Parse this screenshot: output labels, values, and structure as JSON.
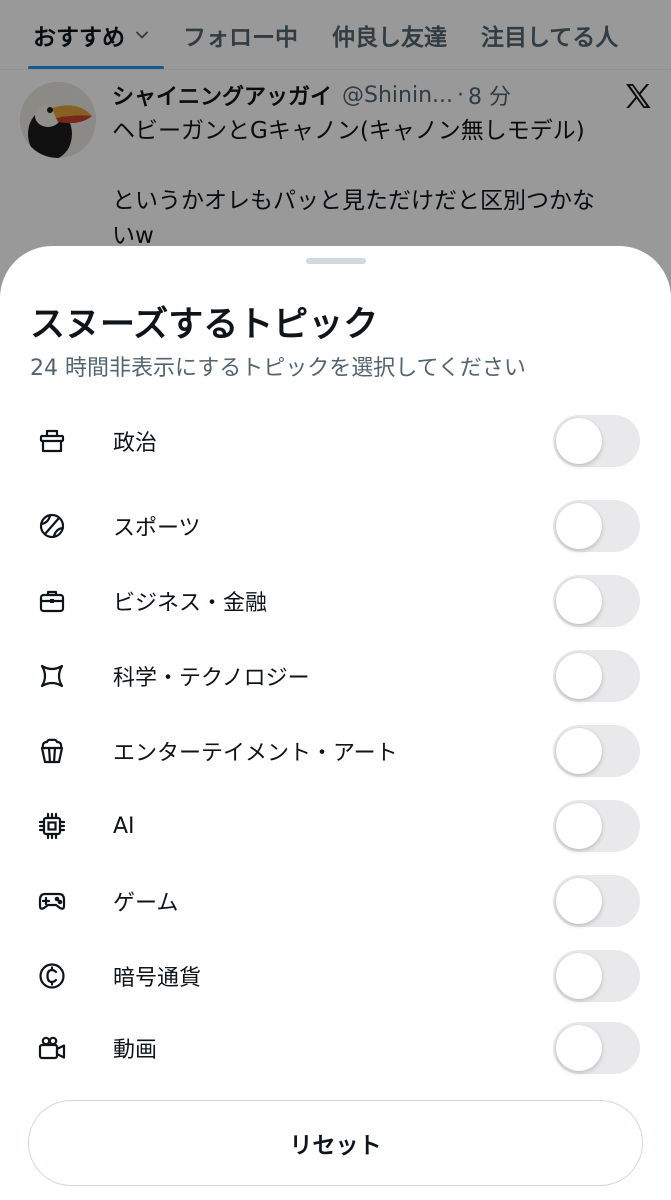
{
  "tabs": [
    {
      "label": "おすすめ",
      "active": true
    },
    {
      "label": "フォロー中",
      "active": false
    },
    {
      "label": "仲良し友達",
      "active": false
    },
    {
      "label": "注目してる人",
      "active": false
    }
  ],
  "post": {
    "name": "シャイニングアッガイ",
    "handle": "@Shinin...",
    "dot": "·",
    "time": "8 分",
    "text": "ヘビーガンとGキャノン(キャノン無しモデル)\n\nというかオレもパッと見ただけだと区別つかな\nいw"
  },
  "sheet": {
    "title": "スヌーズするトピック",
    "subtitle": "24 時間非表示にするトピックを選択してください",
    "topics": [
      {
        "label": "政治",
        "icon": "ballot-box-icon",
        "enabled": false
      },
      {
        "label": "スポーツ",
        "icon": "ball-icon",
        "enabled": false
      },
      {
        "label": "ビジネス・金融",
        "icon": "briefcase-icon",
        "enabled": false
      },
      {
        "label": "科学・テクノロジー",
        "icon": "science-icon",
        "enabled": false
      },
      {
        "label": "エンターテイメント・アート",
        "icon": "popcorn-icon",
        "enabled": false
      },
      {
        "label": "AI",
        "icon": "chip-icon",
        "enabled": false
      },
      {
        "label": "ゲーム",
        "icon": "gamepad-icon",
        "enabled": false
      },
      {
        "label": "暗号通貨",
        "icon": "crypto-coin-icon",
        "enabled": false
      },
      {
        "label": "動画",
        "icon": "video-camera-icon",
        "enabled": false
      }
    ],
    "reset_label": "リセット"
  },
  "colors": {
    "accent": "#1d9bf0",
    "text": "#0f1419",
    "secondary_text": "#536471",
    "toggle_off": "#e9e9eb"
  }
}
